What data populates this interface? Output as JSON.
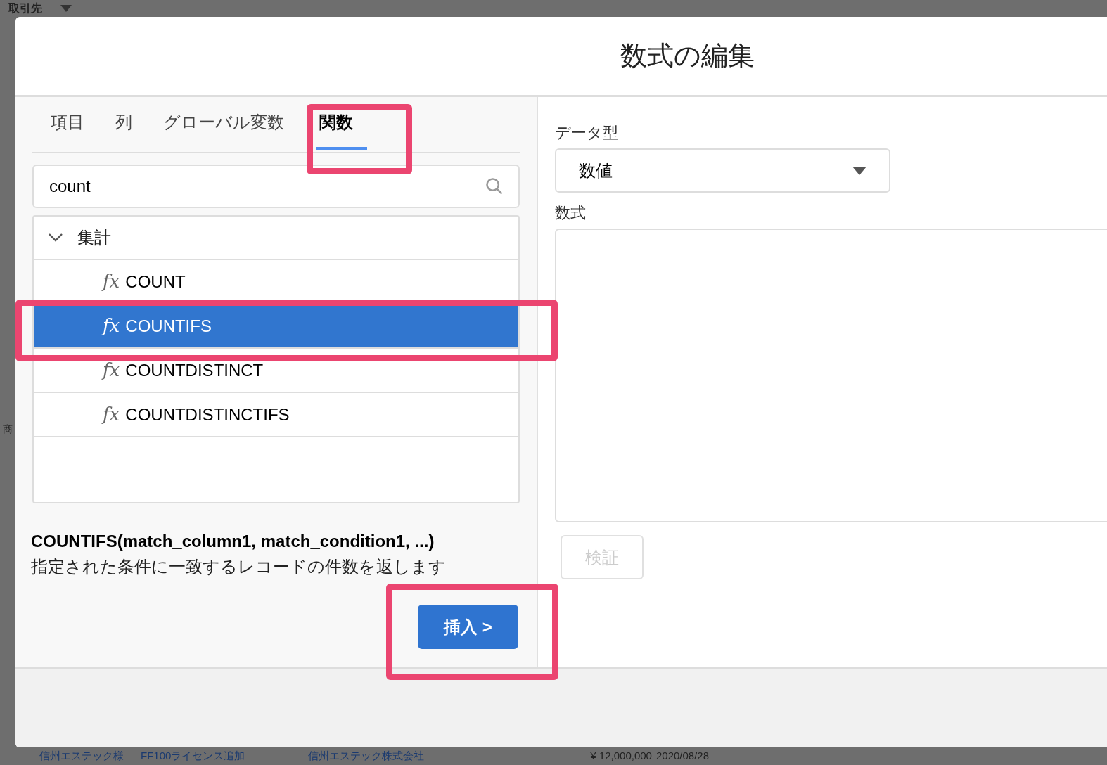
{
  "background": {
    "top_link": "取引先",
    "side_text": "商",
    "bottom_row": [
      "信州エステック様",
      "FF100ライセンス追加",
      "信州エステック株式会社",
      "¥ 12,000,000",
      "2020/08/28"
    ]
  },
  "dialog": {
    "title": "数式の編集",
    "tabs": [
      {
        "label": "項目",
        "selected": false
      },
      {
        "label": "列",
        "selected": false
      },
      {
        "label": "グローバル変数",
        "selected": false
      },
      {
        "label": "関数",
        "selected": true
      }
    ],
    "search": {
      "value": "count"
    },
    "tree": [
      {
        "label": "集計",
        "expanded": true,
        "children": [
          {
            "icon": "fx",
            "label": "COUNT",
            "selected": false
          },
          {
            "icon": "fx",
            "label": "COUNTIFS",
            "selected": true
          },
          {
            "icon": "fx",
            "label": "COUNTDISTINCT",
            "selected": false
          },
          {
            "icon": "fx",
            "label": "COUNTDISTINCTIFS",
            "selected": false
          }
        ]
      }
    ],
    "signature": "COUNTIFS(match_column1, match_condition1, ...)",
    "description": "指定された条件に一致するレコードの件数を返します",
    "insert_button": "挿入 >",
    "data_type_label": "データ型",
    "data_type": {
      "value": "数値"
    },
    "formula_label": "数式",
    "validate_button": {
      "label": "検証",
      "disabled": true
    }
  },
  "annotations": [
    {
      "kind": "tab"
    },
    {
      "kind": "row"
    },
    {
      "kind": "insert"
    }
  ]
}
